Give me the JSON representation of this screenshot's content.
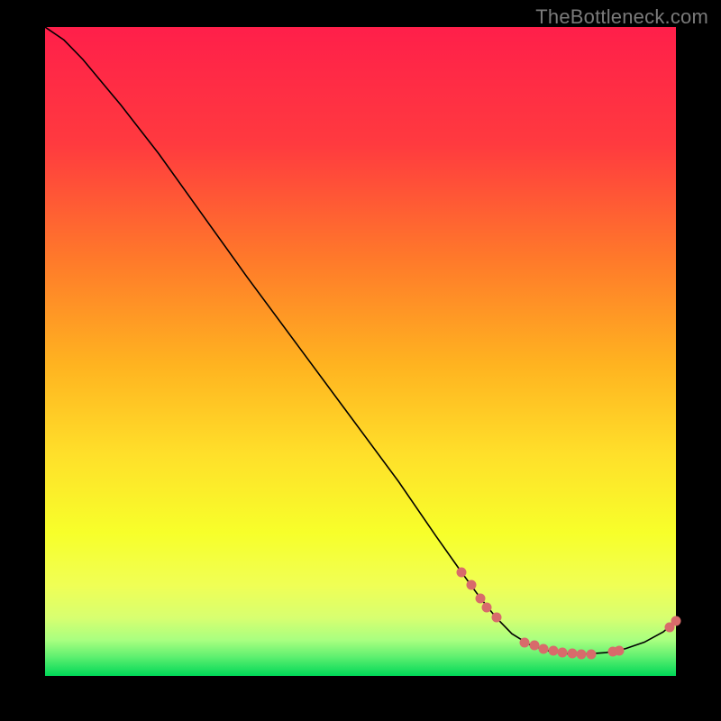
{
  "watermark": "TheBottleneck.com",
  "chart_data": {
    "type": "line",
    "title": "",
    "xlabel": "",
    "ylabel": "",
    "xlim": [
      0,
      100
    ],
    "ylim": [
      0,
      100
    ],
    "gradient_colors": {
      "top": "#ff1f4a",
      "upper_mid": "#ff7a2a",
      "mid": "#ffd22a",
      "lower_mid": "#f7ff2a",
      "low": "#c8ff6a",
      "bottom": "#00e060"
    },
    "curve": [
      {
        "x": 0,
        "y": 100
      },
      {
        "x": 3,
        "y": 98
      },
      {
        "x": 6,
        "y": 95
      },
      {
        "x": 9,
        "y": 91.5
      },
      {
        "x": 12,
        "y": 88
      },
      {
        "x": 18,
        "y": 80.5
      },
      {
        "x": 25,
        "y": 71
      },
      {
        "x": 32,
        "y": 61.5
      },
      {
        "x": 40,
        "y": 51
      },
      {
        "x": 48,
        "y": 40.5
      },
      {
        "x": 56,
        "y": 30
      },
      {
        "x": 62,
        "y": 21.5
      },
      {
        "x": 66,
        "y": 16
      },
      {
        "x": 69,
        "y": 12
      },
      {
        "x": 71.5,
        "y": 9
      },
      {
        "x": 74,
        "y": 6.5
      },
      {
        "x": 77,
        "y": 4.7
      },
      {
        "x": 80,
        "y": 3.8
      },
      {
        "x": 83,
        "y": 3.4
      },
      {
        "x": 86,
        "y": 3.4
      },
      {
        "x": 89,
        "y": 3.6
      },
      {
        "x": 92,
        "y": 4.2
      },
      {
        "x": 95,
        "y": 5.2
      },
      {
        "x": 98,
        "y": 6.8
      },
      {
        "x": 100,
        "y": 8.5
      }
    ],
    "markers": [
      {
        "x": 66,
        "y": 16
      },
      {
        "x": 67.5,
        "y": 14
      },
      {
        "x": 69,
        "y": 12
      },
      {
        "x": 70,
        "y": 10.5
      },
      {
        "x": 71.5,
        "y": 9
      },
      {
        "x": 76,
        "y": 5.2
      },
      {
        "x": 77.5,
        "y": 4.7
      },
      {
        "x": 79,
        "y": 4.2
      },
      {
        "x": 80.5,
        "y": 3.9
      },
      {
        "x": 82,
        "y": 3.6
      },
      {
        "x": 83.5,
        "y": 3.5
      },
      {
        "x": 85,
        "y": 3.4
      },
      {
        "x": 86.5,
        "y": 3.4
      },
      {
        "x": 90,
        "y": 3.7
      },
      {
        "x": 91,
        "y": 3.9
      },
      {
        "x": 99,
        "y": 7.5
      },
      {
        "x": 100,
        "y": 8.5
      }
    ]
  }
}
